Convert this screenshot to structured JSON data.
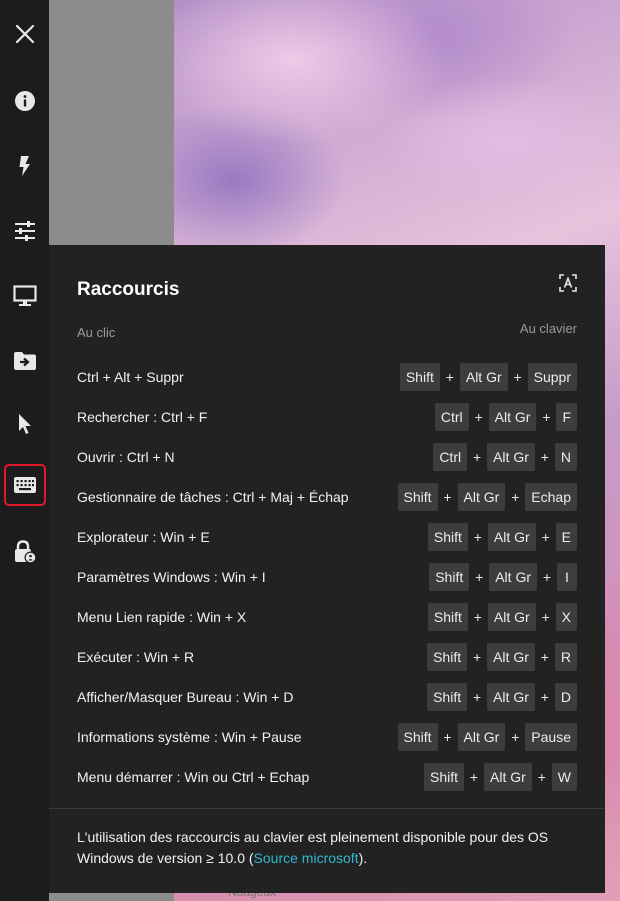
{
  "background": {
    "caption": "Nuageux"
  },
  "sidebar": {
    "items": [
      {
        "icon": "close-icon",
        "name": "close-button"
      },
      {
        "icon": "info-icon",
        "name": "info-button"
      },
      {
        "icon": "lightning-icon",
        "name": "quick-actions-button"
      },
      {
        "icon": "sliders-icon",
        "name": "settings-button"
      },
      {
        "icon": "monitor-icon",
        "name": "display-button"
      },
      {
        "icon": "folder-transfer-icon",
        "name": "file-transfer-button"
      },
      {
        "icon": "cursor-icon",
        "name": "pointer-button"
      },
      {
        "icon": "keyboard-icon",
        "name": "keyboard-shortcuts-button",
        "active": true
      },
      {
        "icon": "lock-user-icon",
        "name": "lock-session-button"
      }
    ],
    "active_color": "#e3182a"
  },
  "panel": {
    "title": "Raccourcis",
    "column_left": "Au clic",
    "column_right": "Au clavier",
    "shortcuts": [
      {
        "label": "Ctrl + Alt + Suppr",
        "keys": [
          "Shift",
          "Alt Gr",
          "Suppr"
        ]
      },
      {
        "label": "Rechercher : Ctrl + F",
        "keys": [
          "Ctrl",
          "Alt Gr",
          "F"
        ]
      },
      {
        "label": "Ouvrir : Ctrl + N",
        "keys": [
          "Ctrl",
          "Alt Gr",
          "N"
        ]
      },
      {
        "label": "Gestionnaire de tâches : Ctrl + Maj + Échap",
        "keys": [
          "Shift",
          "Alt Gr",
          "Echap"
        ]
      },
      {
        "label": "Explorateur : Win + E",
        "keys": [
          "Shift",
          "Alt Gr",
          "E"
        ]
      },
      {
        "label": "Paramètres Windows : Win + I",
        "keys": [
          "Shift",
          "Alt Gr",
          "I"
        ]
      },
      {
        "label": "Menu Lien rapide : Win + X",
        "keys": [
          "Shift",
          "Alt Gr",
          "X"
        ]
      },
      {
        "label": "Exécuter : Win + R",
        "keys": [
          "Shift",
          "Alt Gr",
          "R"
        ]
      },
      {
        "label": "Afficher/Masquer Bureau : Win + D",
        "keys": [
          "Shift",
          "Alt Gr",
          "D"
        ]
      },
      {
        "label": "Informations système : Win + Pause",
        "keys": [
          "Shift",
          "Alt Gr",
          "Pause"
        ]
      },
      {
        "label": "Menu démarrer : Win ou Ctrl + Echap",
        "keys": [
          "Shift",
          "Alt Gr",
          "W"
        ]
      }
    ],
    "separator": "+",
    "footer_text_before": "L'utilisation des raccourcis au clavier est pleinement disponible pour des OS Windows de version ≥ 10.0 (",
    "footer_link": "Source microsoft",
    "footer_text_after": ").",
    "link_color": "#2db8d4"
  }
}
